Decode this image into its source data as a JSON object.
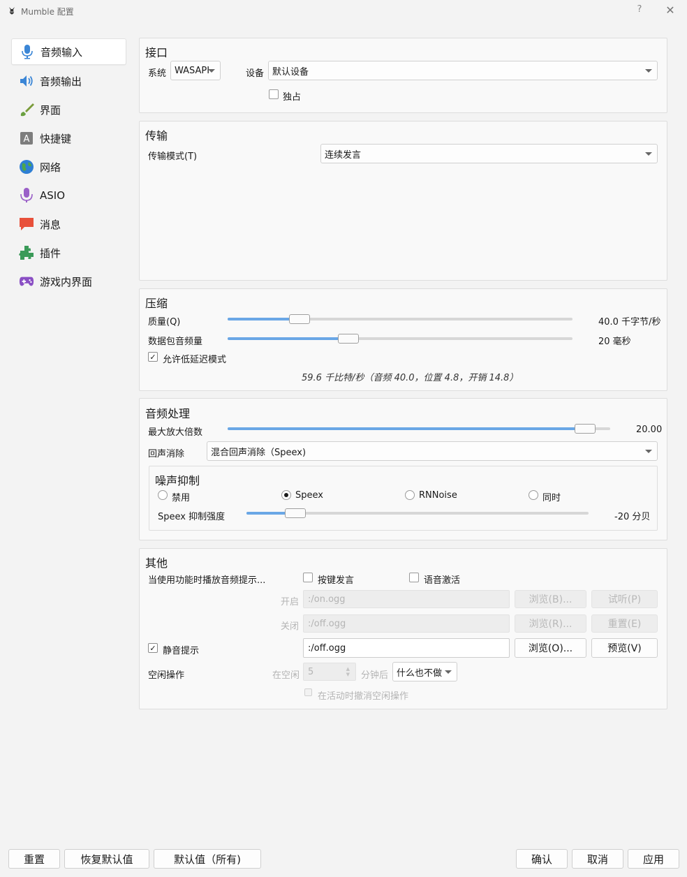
{
  "window": {
    "title": "Mumble 配置",
    "help": "?",
    "close": "✕"
  },
  "sidebar": {
    "items": [
      {
        "label": "音频输入",
        "icon": "microphone-icon",
        "active": true
      },
      {
        "label": "音频输出",
        "icon": "speaker-icon"
      },
      {
        "label": "界面",
        "icon": "brush-icon"
      },
      {
        "label": "快捷键",
        "icon": "keyboard-icon"
      },
      {
        "label": "网络",
        "icon": "globe-icon"
      },
      {
        "label": "ASIO",
        "icon": "asio-mic-icon"
      },
      {
        "label": "消息",
        "icon": "chat-bubble-icon"
      },
      {
        "label": "插件",
        "icon": "puzzle-icon"
      },
      {
        "label": "游戏内界面",
        "icon": "gamepad-icon"
      }
    ]
  },
  "interface": {
    "title": "接口",
    "system_label": "系统",
    "system_value": "WASAPI",
    "device_label": "设备",
    "device_value": "默认设备",
    "exclusive_label": "独占",
    "exclusive_checked": false
  },
  "transmission": {
    "title": "传输",
    "mode_label": "传输模式(T)",
    "mode_value": "连续发言"
  },
  "compression": {
    "title": "压缩",
    "quality_label": "质量(Q)",
    "quality_value": "40.0 千字节/秒",
    "quality_fraction": 0.19,
    "frames_label": "数据包音频量",
    "frames_value": "20 毫秒",
    "frames_fraction": 0.34,
    "low_latency_label": "允许低延迟模式",
    "low_latency_checked": true,
    "summary": "59.6 千比特/秒（音频 40.0，位置 4.8，开销 14.8）"
  },
  "processing": {
    "title": "音频处理",
    "max_amp_label": "最大放大倍数",
    "max_amp_value": "20.00",
    "max_amp_fraction": 0.96,
    "echo_label": "回声消除",
    "echo_value": "混合回声消除（Speex)",
    "noise": {
      "title": "噪声抑制",
      "options": [
        "禁用",
        "Speex",
        "RNNoise",
        "同时"
      ],
      "selected": "Speex",
      "strength_label": "Speex 抑制强度",
      "strength_value": "-20 分贝",
      "strength_fraction": 0.12
    }
  },
  "misc": {
    "title": "其他",
    "cue_label": "当使用功能时播放音频提示...",
    "ptt_label": "按键发言",
    "va_label": "语音激活",
    "on_label": "开启",
    "on_value": ":/on.ogg",
    "off_label": "关闭",
    "off_value": ":/off.ogg",
    "browse_b": "浏览(B)...",
    "preview_p": "试听(P)",
    "browse_r": "浏览(R)...",
    "reset_e": "重置(E)",
    "mute_cue_label": "静音提示",
    "mute_cue_checked": true,
    "mute_value": ":/off.ogg",
    "browse_o": "浏览(O)...",
    "preview_v": "预览(V)",
    "idle_label": "空闲操作",
    "idle_after_label": "在空闲",
    "idle_minutes": "5",
    "idle_minutes_suffix": "分钟后",
    "idle_action": "什么也不做",
    "undo_idle_label": "在活动时撤消空闲操作"
  },
  "footer": {
    "reset": "重置",
    "restore_defaults": "恢复默认值",
    "defaults_all": "默认值（所有)",
    "ok": "确认",
    "cancel": "取消",
    "apply": "应用"
  },
  "colors": {
    "accent": "#6aa7e6",
    "window_bg": "#f3f3f3",
    "group_bg": "#f9f9f9"
  }
}
